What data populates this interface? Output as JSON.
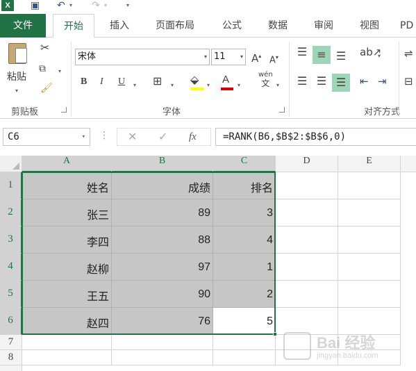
{
  "quick_access": {
    "app_logo": "X"
  },
  "ribbon_tabs": [
    "文件",
    "开始",
    "插入",
    "页面布局",
    "公式",
    "数据",
    "审阅",
    "视图",
    "PD"
  ],
  "ribbon": {
    "clipboard": {
      "paste_label": "粘贴",
      "group_label": "剪贴板"
    },
    "font": {
      "font_name": "宋体",
      "font_size": "11",
      "bold": "B",
      "italic": "I",
      "underline": "U",
      "grow_font": "A",
      "shrink_font": "A",
      "font_color_glyph": "A",
      "phonetic_glyph": "wén",
      "phonetic_char": "文",
      "group_label": "字体"
    },
    "alignment": {
      "group_label": "对齐方式"
    }
  },
  "formula_bar": {
    "name_box": "C6",
    "cancel": "✕",
    "enter": "✓",
    "fx": "fx",
    "formula": "=RANK(B6,$B$2:$B$6,0)"
  },
  "grid": {
    "columns": [
      "A",
      "B",
      "C",
      "D",
      "E"
    ],
    "rows": [
      "1",
      "2",
      "3",
      "4",
      "5",
      "6",
      "7",
      "8"
    ],
    "table": [
      [
        "姓名",
        "成绩",
        "排名"
      ],
      [
        "张三",
        "89",
        "3"
      ],
      [
        "李四",
        "88",
        "4"
      ],
      [
        "赵柳",
        "97",
        "1"
      ],
      [
        "王五",
        "90",
        "2"
      ],
      [
        "赵四",
        "76",
        "5"
      ]
    ]
  },
  "watermark": {
    "brand": "Bai 经验",
    "url": "jingyan.baidu.com"
  },
  "colors": {
    "accent": "#217346",
    "selection_fill": "#c6c6c6",
    "highlight": "#9fd5b7"
  }
}
